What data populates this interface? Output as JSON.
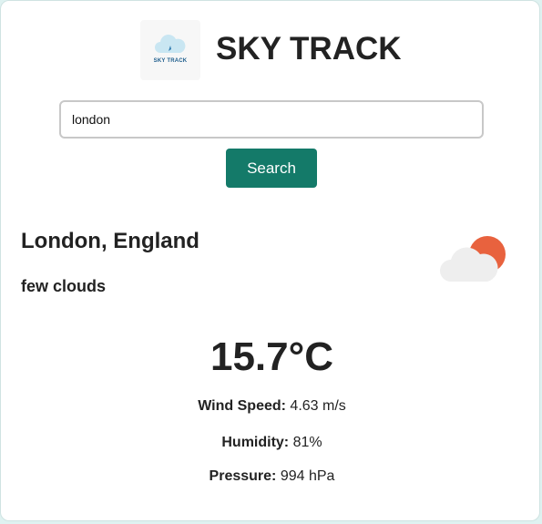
{
  "header": {
    "logo_text": "SKY TRACK",
    "title": "SKY TRACK"
  },
  "search": {
    "value": "london",
    "button_label": "Search"
  },
  "weather": {
    "city": "London, England",
    "description": "few clouds",
    "icon": "few-clouds-icon",
    "temperature": "15.7°C",
    "wind_label": "Wind Speed:",
    "wind_value": "4.63 m/s",
    "humidity_label": "Humidity:",
    "humidity_value": "81%",
    "pressure_label": "Pressure:",
    "pressure_value": "994 hPa"
  },
  "colors": {
    "accent": "#147a69",
    "sun": "#e8623e",
    "cloud": "#eeeeee"
  }
}
